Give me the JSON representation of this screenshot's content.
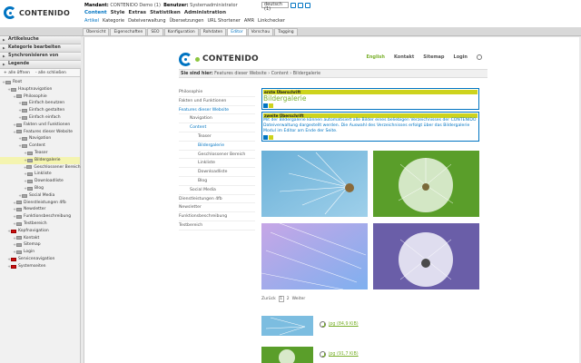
{
  "header": {
    "logo_text": "CONTENIDO",
    "mandant_label": "Mandant:",
    "mandant_value": "CONTENIDO Demo (1)",
    "user_label": "Benutzer:",
    "user_value": "Systemadministrator",
    "language_select": "deutsch (1)",
    "main_menu": [
      "Content",
      "Style",
      "Extras",
      "Statistiken",
      "Administration"
    ],
    "sub_menu": [
      "Artikel",
      "Kategorie",
      "Dateiverwaltung",
      "Übersetzungen",
      "URL Shortener",
      "AMR",
      "Linkchecker"
    ]
  },
  "tabs": [
    "Übersicht",
    "Eigenschaften",
    "SEO",
    "Konfiguration",
    "Rohdaten",
    "Editor",
    "Vorschau",
    "Tagging"
  ],
  "active_tab": "Editor",
  "left": {
    "bars": [
      "Artikelsuche",
      "Kategorie bearbeiten",
      "Synchronisieren von",
      "Legende"
    ],
    "expand_all": "+ alle öffnen",
    "collapse_all": "- alle schließen",
    "tree": [
      {
        "label": "Root",
        "level": 0,
        "type": "root"
      },
      {
        "label": "Hauptnavigation",
        "level": 1,
        "type": "grey"
      },
      {
        "label": "Philosophie",
        "level": 2,
        "type": "grey"
      },
      {
        "label": "Einfach benutzen",
        "level": 3,
        "type": "grey"
      },
      {
        "label": "Einfach gestalten",
        "level": 3,
        "type": "grey"
      },
      {
        "label": "Einfach einfach",
        "level": 3,
        "type": "grey"
      },
      {
        "label": "Fakten und Funktionen",
        "level": 2,
        "type": "grey"
      },
      {
        "label": "Features dieser Website",
        "level": 2,
        "type": "grey"
      },
      {
        "label": "Navigation",
        "level": 3,
        "type": "grey"
      },
      {
        "label": "Content",
        "level": 3,
        "type": "grey"
      },
      {
        "label": "Teaser",
        "level": 4,
        "type": "grey"
      },
      {
        "label": "Bildergalerie",
        "level": 4,
        "type": "grey",
        "selected": true
      },
      {
        "label": "Geschlossener Bereich",
        "level": 4,
        "type": "grey"
      },
      {
        "label": "Linkliste",
        "level": 4,
        "type": "grey"
      },
      {
        "label": "Downloadliste",
        "level": 4,
        "type": "grey"
      },
      {
        "label": "Blog",
        "level": 4,
        "type": "grey"
      },
      {
        "label": "Social Media",
        "level": 3,
        "type": "grey"
      },
      {
        "label": "Dienstleistungen 4fb",
        "level": 2,
        "type": "grey"
      },
      {
        "label": "Newsletter",
        "level": 2,
        "type": "grey"
      },
      {
        "label": "Funktionsbeschreibung",
        "level": 2,
        "type": "grey"
      },
      {
        "label": "Testbereich",
        "level": 2,
        "type": "grey"
      },
      {
        "label": "Kopfnavigation",
        "level": 1,
        "type": "red"
      },
      {
        "label": "Kontakt",
        "level": 2,
        "type": "grey"
      },
      {
        "label": "Sitemap",
        "level": 2,
        "type": "grey"
      },
      {
        "label": "Login",
        "level": 2,
        "type": "grey"
      },
      {
        "label": "Servicenavigation",
        "level": 1,
        "type": "red"
      },
      {
        "label": "Systemseiten",
        "level": 1,
        "type": "red"
      }
    ]
  },
  "site": {
    "logo_text": "CONTENIDO",
    "nav": [
      "English",
      "Kontakt",
      "Sitemap",
      "Login"
    ],
    "breadcrumb_label": "Sie sind hier:",
    "breadcrumb": "Features dieser Website › Content › Bildergalerie",
    "side_nav": [
      {
        "label": "Philosophie",
        "level": 1
      },
      {
        "label": "Fakten und Funktionen",
        "level": 1
      },
      {
        "label": "Features dieser Website",
        "level": 1,
        "active": true
      },
      {
        "label": "Navigation",
        "level": 2
      },
      {
        "label": "Content",
        "level": 2,
        "active": true
      },
      {
        "label": "Teaser",
        "level": 3
      },
      {
        "label": "Bildergalerie",
        "level": 3,
        "active": true
      },
      {
        "label": "Geschlossener Bereich",
        "level": 3
      },
      {
        "label": "Linkliste",
        "level": 3
      },
      {
        "label": "Downloadliste",
        "level": 3
      },
      {
        "label": "Blog",
        "level": 3
      },
      {
        "label": "Social Media",
        "level": 2
      },
      {
        "label": "Dienstleistungen 4fb",
        "level": 1
      },
      {
        "label": "Newsletter",
        "level": 1
      },
      {
        "label": "Funktionsbeschreibung",
        "level": 1
      },
      {
        "label": "Testbereich",
        "level": 1
      }
    ],
    "h1_label": "erste Überschrift",
    "h1_text": "Bildergalerie",
    "h2_label": "zweite Überschrift",
    "paragraph": "Mit der Bildergalerie können automatisiert alle Bilder eines beliebigen Verzeichnisses der CONTENIDO Dateiverwaltung dargestellt werden. Die Auswahl des Verzeichnisses erfolgt über das Bildergalerie Modul im Editor am Ende der Seite.",
    "pagination": {
      "prev": "Zurück",
      "pages": [
        "1",
        "2"
      ],
      "current": "1",
      "next": "Weiter"
    },
    "downloads": [
      "jpg (84,9 KiB)",
      "jpg (91,7 KiB)"
    ]
  },
  "colors": {
    "accent": "#0074c2",
    "green": "#7ab02c",
    "headbar": "#cdd31d",
    "folder_red": "#cc1010"
  }
}
